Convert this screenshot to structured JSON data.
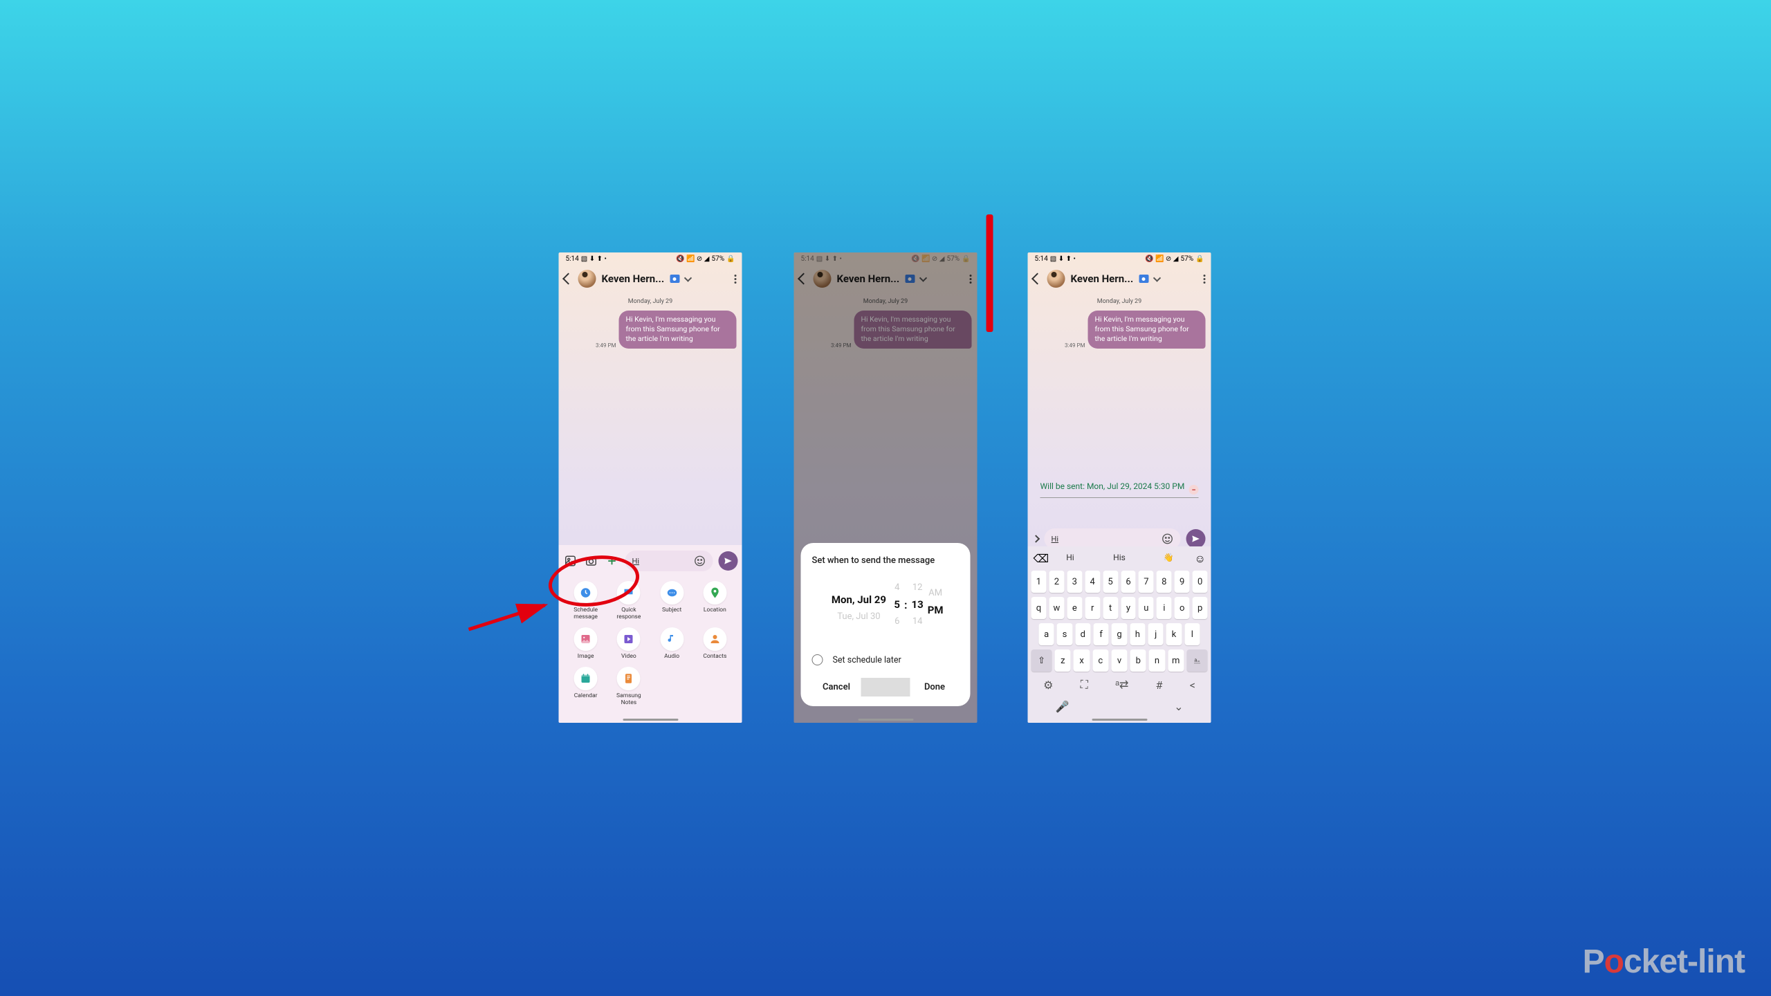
{
  "status": {
    "time": "5:14",
    "battery": "57%"
  },
  "contact": {
    "name": "Keven Hern..."
  },
  "conversation": {
    "date_header": "Monday, July 29",
    "msg_time": "3:49 PM",
    "msg_text": "Hi Kevin, I'm messaging you from this Samsung phone for the article I'm writing"
  },
  "composer": {
    "draft": "Hi"
  },
  "attachments": {
    "schedule": "Schedule\nmessage",
    "quick": "Quick\nresponse",
    "subject": "Subject",
    "location": "Location",
    "image": "Image",
    "video": "Video",
    "audio": "Audio",
    "contacts": "Contacts",
    "calendar": "Calendar",
    "notes": "Samsung\nNotes"
  },
  "sheet": {
    "title": "Set when to send the message",
    "date_prev": "",
    "date_sel": "Mon, Jul 29",
    "date_next": "Tue, Jul 30",
    "hour_prev": "4",
    "hour_sel": "5",
    "hour_next": "6",
    "min_prev": "12",
    "min_sel": "13",
    "min_next": "14",
    "ampm_prev": "AM",
    "ampm_sel": "PM",
    "ampm_next": "",
    "later": "Set schedule later",
    "cancel": "Cancel",
    "done": "Done"
  },
  "schedule_banner": "Will be sent: Mon, Jul 29, 2024 5:30 PM",
  "suggestions": {
    "s1": "Hi",
    "s2": "His",
    "s3": "👋"
  },
  "watermark": {
    "p1": "P",
    "p2": "o",
    "p3": "cket-lint"
  }
}
